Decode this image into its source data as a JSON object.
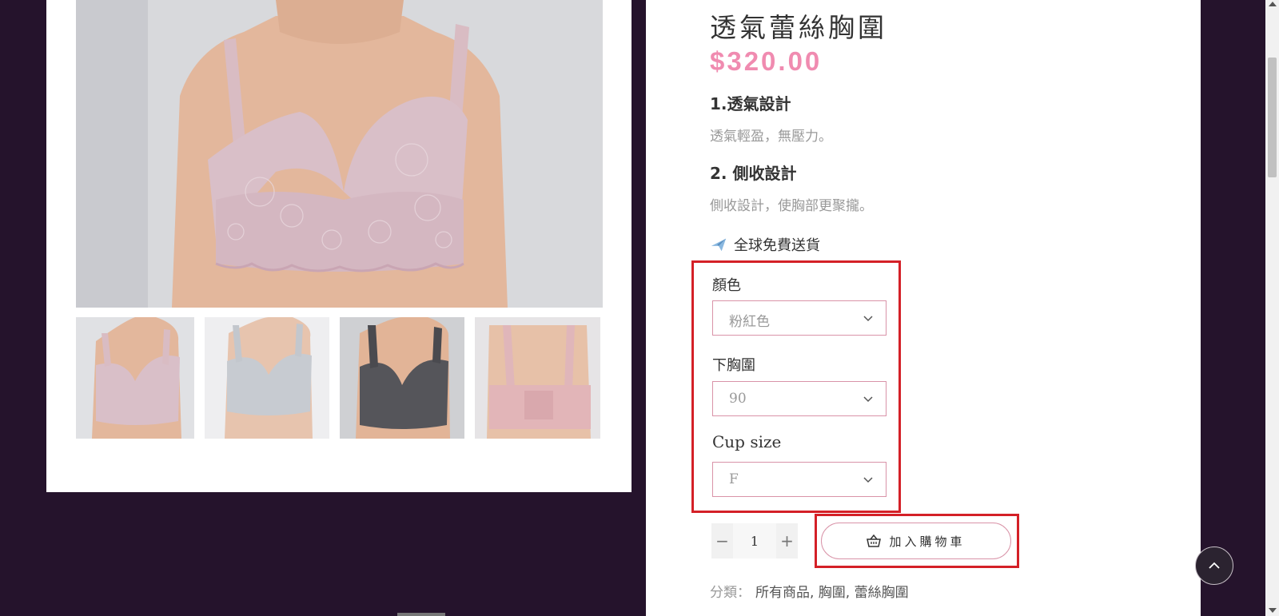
{
  "product": {
    "title": "透氣蕾絲胸圍",
    "price": "$320.00",
    "features": [
      {
        "title": "1.透氣設計",
        "desc": "透氣輕盈，無壓力。"
      },
      {
        "title": "2. 側收設計",
        "desc": "側收設計，使胸部更聚攏。"
      }
    ],
    "shipping": "全球免費送貨",
    "shipping_icon": "airplane-icon"
  },
  "options": {
    "color": {
      "label": "顏色",
      "value": "粉紅色"
    },
    "band": {
      "label": "下胸圍",
      "value": "90"
    },
    "cup": {
      "label": "Cup size",
      "value": "F"
    }
  },
  "quantity": {
    "minus": "−",
    "value": "1",
    "plus": "+"
  },
  "cart": {
    "label": "加入購物車",
    "icon": "basket-icon"
  },
  "category": {
    "label": "分類：",
    "links": "所有商品, 胸圍, 蕾絲胸圍"
  },
  "gallery": {
    "thumbnails": [
      "pink-lace-front",
      "grey-lace-front",
      "black-lace-front",
      "pink-back"
    ]
  },
  "colors": {
    "price": "#f08bb0",
    "highlight_border": "#d42027",
    "select_border": "#d993a8",
    "page_background": "#25132c"
  }
}
